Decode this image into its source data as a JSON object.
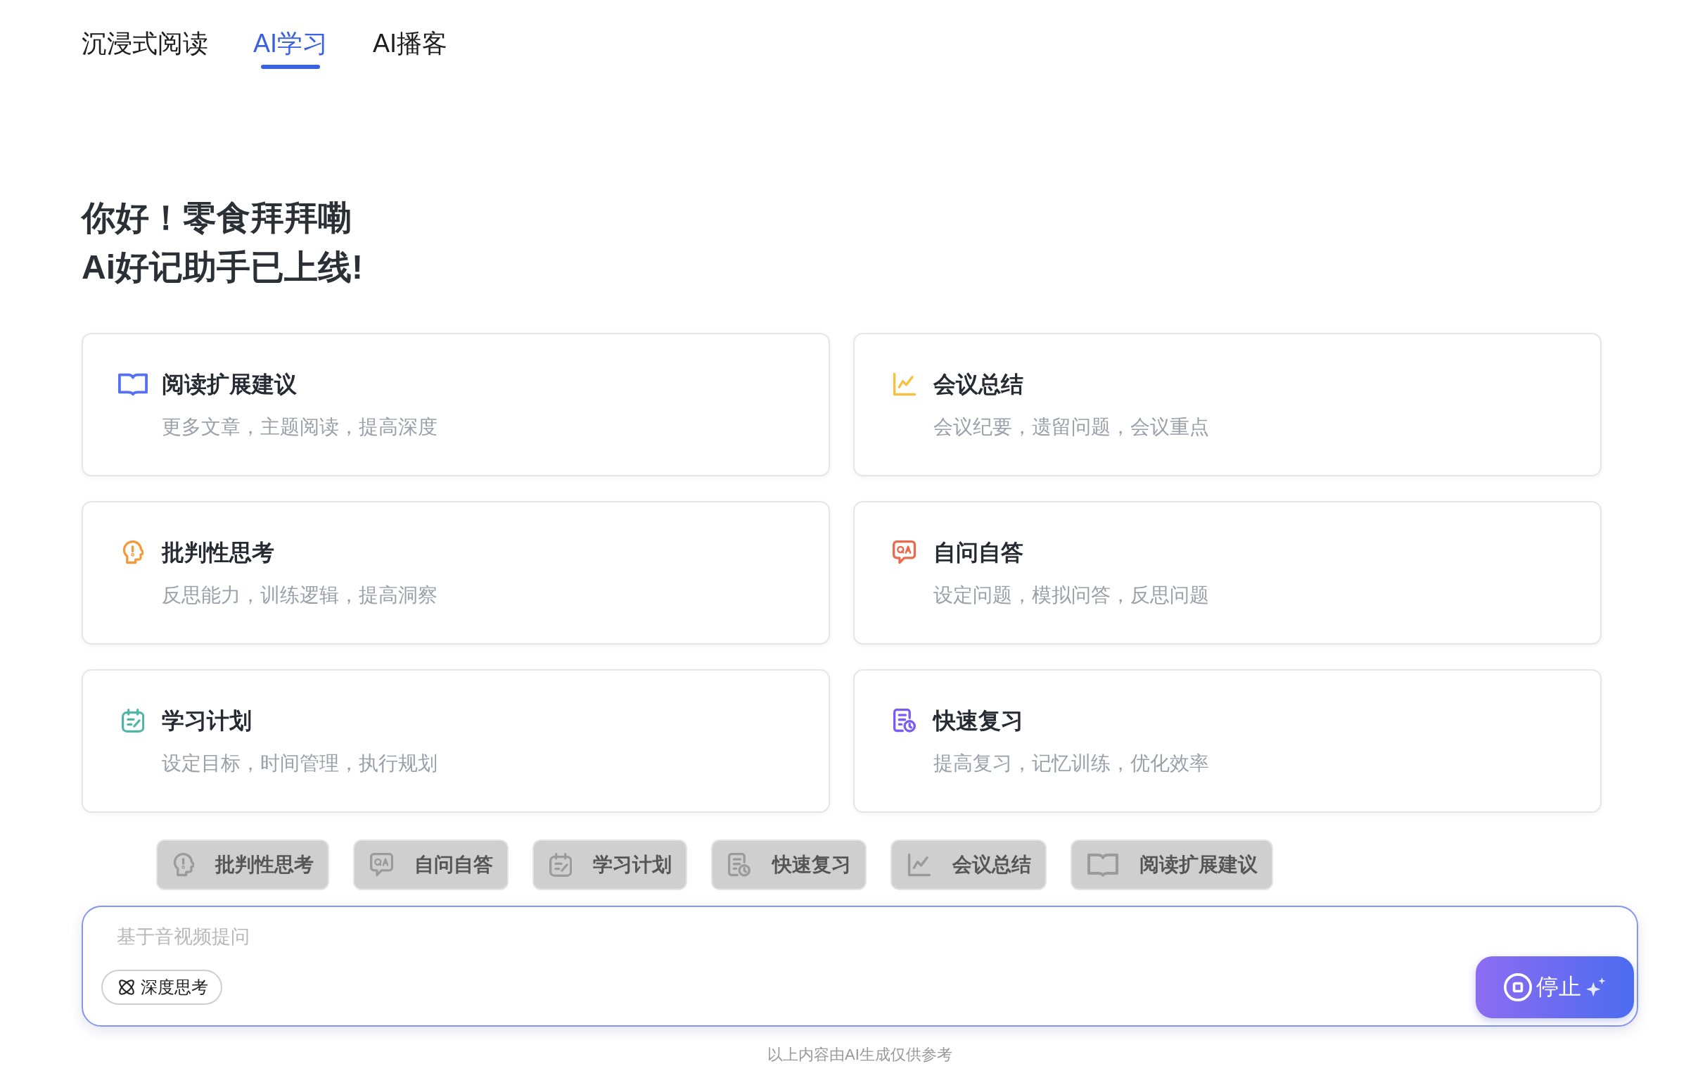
{
  "tabs": [
    {
      "label": "沉浸式阅读",
      "selected": false
    },
    {
      "label": "AI学习",
      "selected": true
    },
    {
      "label": "AI播客",
      "selected": false
    }
  ],
  "greeting": {
    "lines": [
      "你好！零食拜拜嘞",
      "Ai好记助手已上线!"
    ]
  },
  "cards": [
    {
      "kind": "book",
      "title": "阅读扩展建议",
      "description": "更多文章，主题阅读，提高深度",
      "color": "#5571f6"
    },
    {
      "kind": "chart",
      "title": "会议总结",
      "description": "会议纪要，遗留问题，会议重点",
      "color": "#f5c143"
    },
    {
      "kind": "head",
      "title": "批判性思考",
      "description": "反思能力，训练逻辑，提高洞察",
      "color": "#f39a3b"
    },
    {
      "kind": "qa",
      "title": "自问自答",
      "description": "设定问题，模拟问答，反思问题",
      "color": "#ec6a4c"
    },
    {
      "kind": "calendar",
      "title": "学习计划",
      "description": "设定目标，时间管理，执行规划",
      "color": "#4fb6a6"
    },
    {
      "kind": "review",
      "title": "快速复习",
      "description": "提高复习，记忆训练，优化效率",
      "color": "#7a5cf2"
    }
  ],
  "chips": [
    {
      "kind": "head",
      "label": "批判性思考",
      "disabled": true
    },
    {
      "kind": "qa",
      "label": "自问自答",
      "disabled": true
    },
    {
      "kind": "calendar",
      "label": "学习计划",
      "disabled": true
    },
    {
      "kind": "review",
      "label": "快速复习",
      "disabled": true
    },
    {
      "kind": "chart",
      "label": "会议总结",
      "disabled": true
    },
    {
      "kind": "book",
      "label": "阅读扩展建议",
      "disabled": true
    }
  ],
  "composer": {
    "placeholder": "基于音视频提问",
    "deep_think_button": {
      "label": "深度思考"
    },
    "stop_button": {
      "label": "停止"
    }
  },
  "disclaimer": "以上内容由AI生成仅供参考"
}
